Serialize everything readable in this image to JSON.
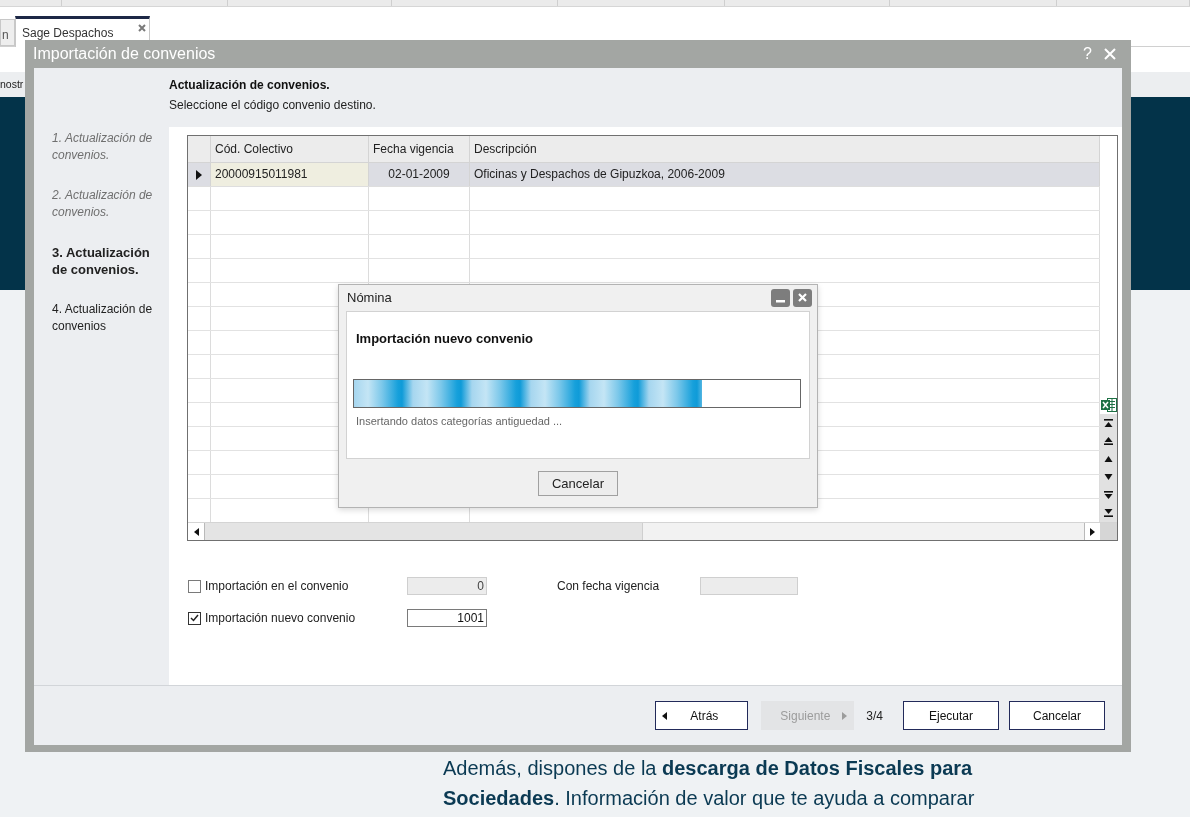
{
  "browser_tabs": [
    {
      "label": "n",
      "selected": false
    },
    {
      "label": "Sage Despachos",
      "selected": true
    }
  ],
  "menu_fragment": "nostr",
  "wizard": {
    "title": "Importación de convenios",
    "help": "?",
    "header": {
      "title": "Actualización de convenios.",
      "subtitle": "Seleccione el código convenio destino."
    },
    "steps": [
      {
        "label": "1. Actualización de convenios.",
        "completed": true,
        "selected": false
      },
      {
        "label": "2. Actualización de convenios.",
        "completed": true,
        "selected": false
      },
      {
        "label": "3. Actualización de convenios.",
        "completed": false,
        "selected": true
      },
      {
        "label": "4. Actualización de convenios",
        "completed": false,
        "selected": false
      }
    ],
    "table": {
      "columns": [
        "Cód. Colectivo",
        "Fecha vigencia",
        "Descripción"
      ],
      "rows": [
        {
          "cells": [
            "20000915011981",
            "02-01-2009",
            "Oficinas y Despachos de Gipuzkoa, 2006-2009"
          ],
          "selected": true
        }
      ]
    },
    "options": [
      {
        "label": "Importación en el convenio",
        "checked": false,
        "value": "0",
        "disabled": true
      },
      {
        "label": "Importación nuevo convenio",
        "checked": true,
        "value": "1001",
        "disabled": false
      }
    ],
    "date_filter": {
      "label": "Con fecha vigencia",
      "disabled": true
    },
    "nav_buttons": [
      {
        "label": "Atrás",
        "kind": "back",
        "disabled": false
      },
      {
        "label": "Siguiente",
        "kind": "next",
        "disabled": true
      }
    ],
    "step_counter": "3/4",
    "action_buttons": [
      "Ejecutar",
      "Cancelar"
    ]
  },
  "progress_dialog": {
    "title": "Nómina",
    "heading": "Importación nuevo convenio",
    "level": 0.78,
    "status": "Insertando datos categorías antiguedad ...",
    "button": "Cancelar"
  },
  "promo_text": "Además, dispones de la **descarga de Datos Fiscales para Sociedades**. Información de valor que te ayuda a comparar"
}
